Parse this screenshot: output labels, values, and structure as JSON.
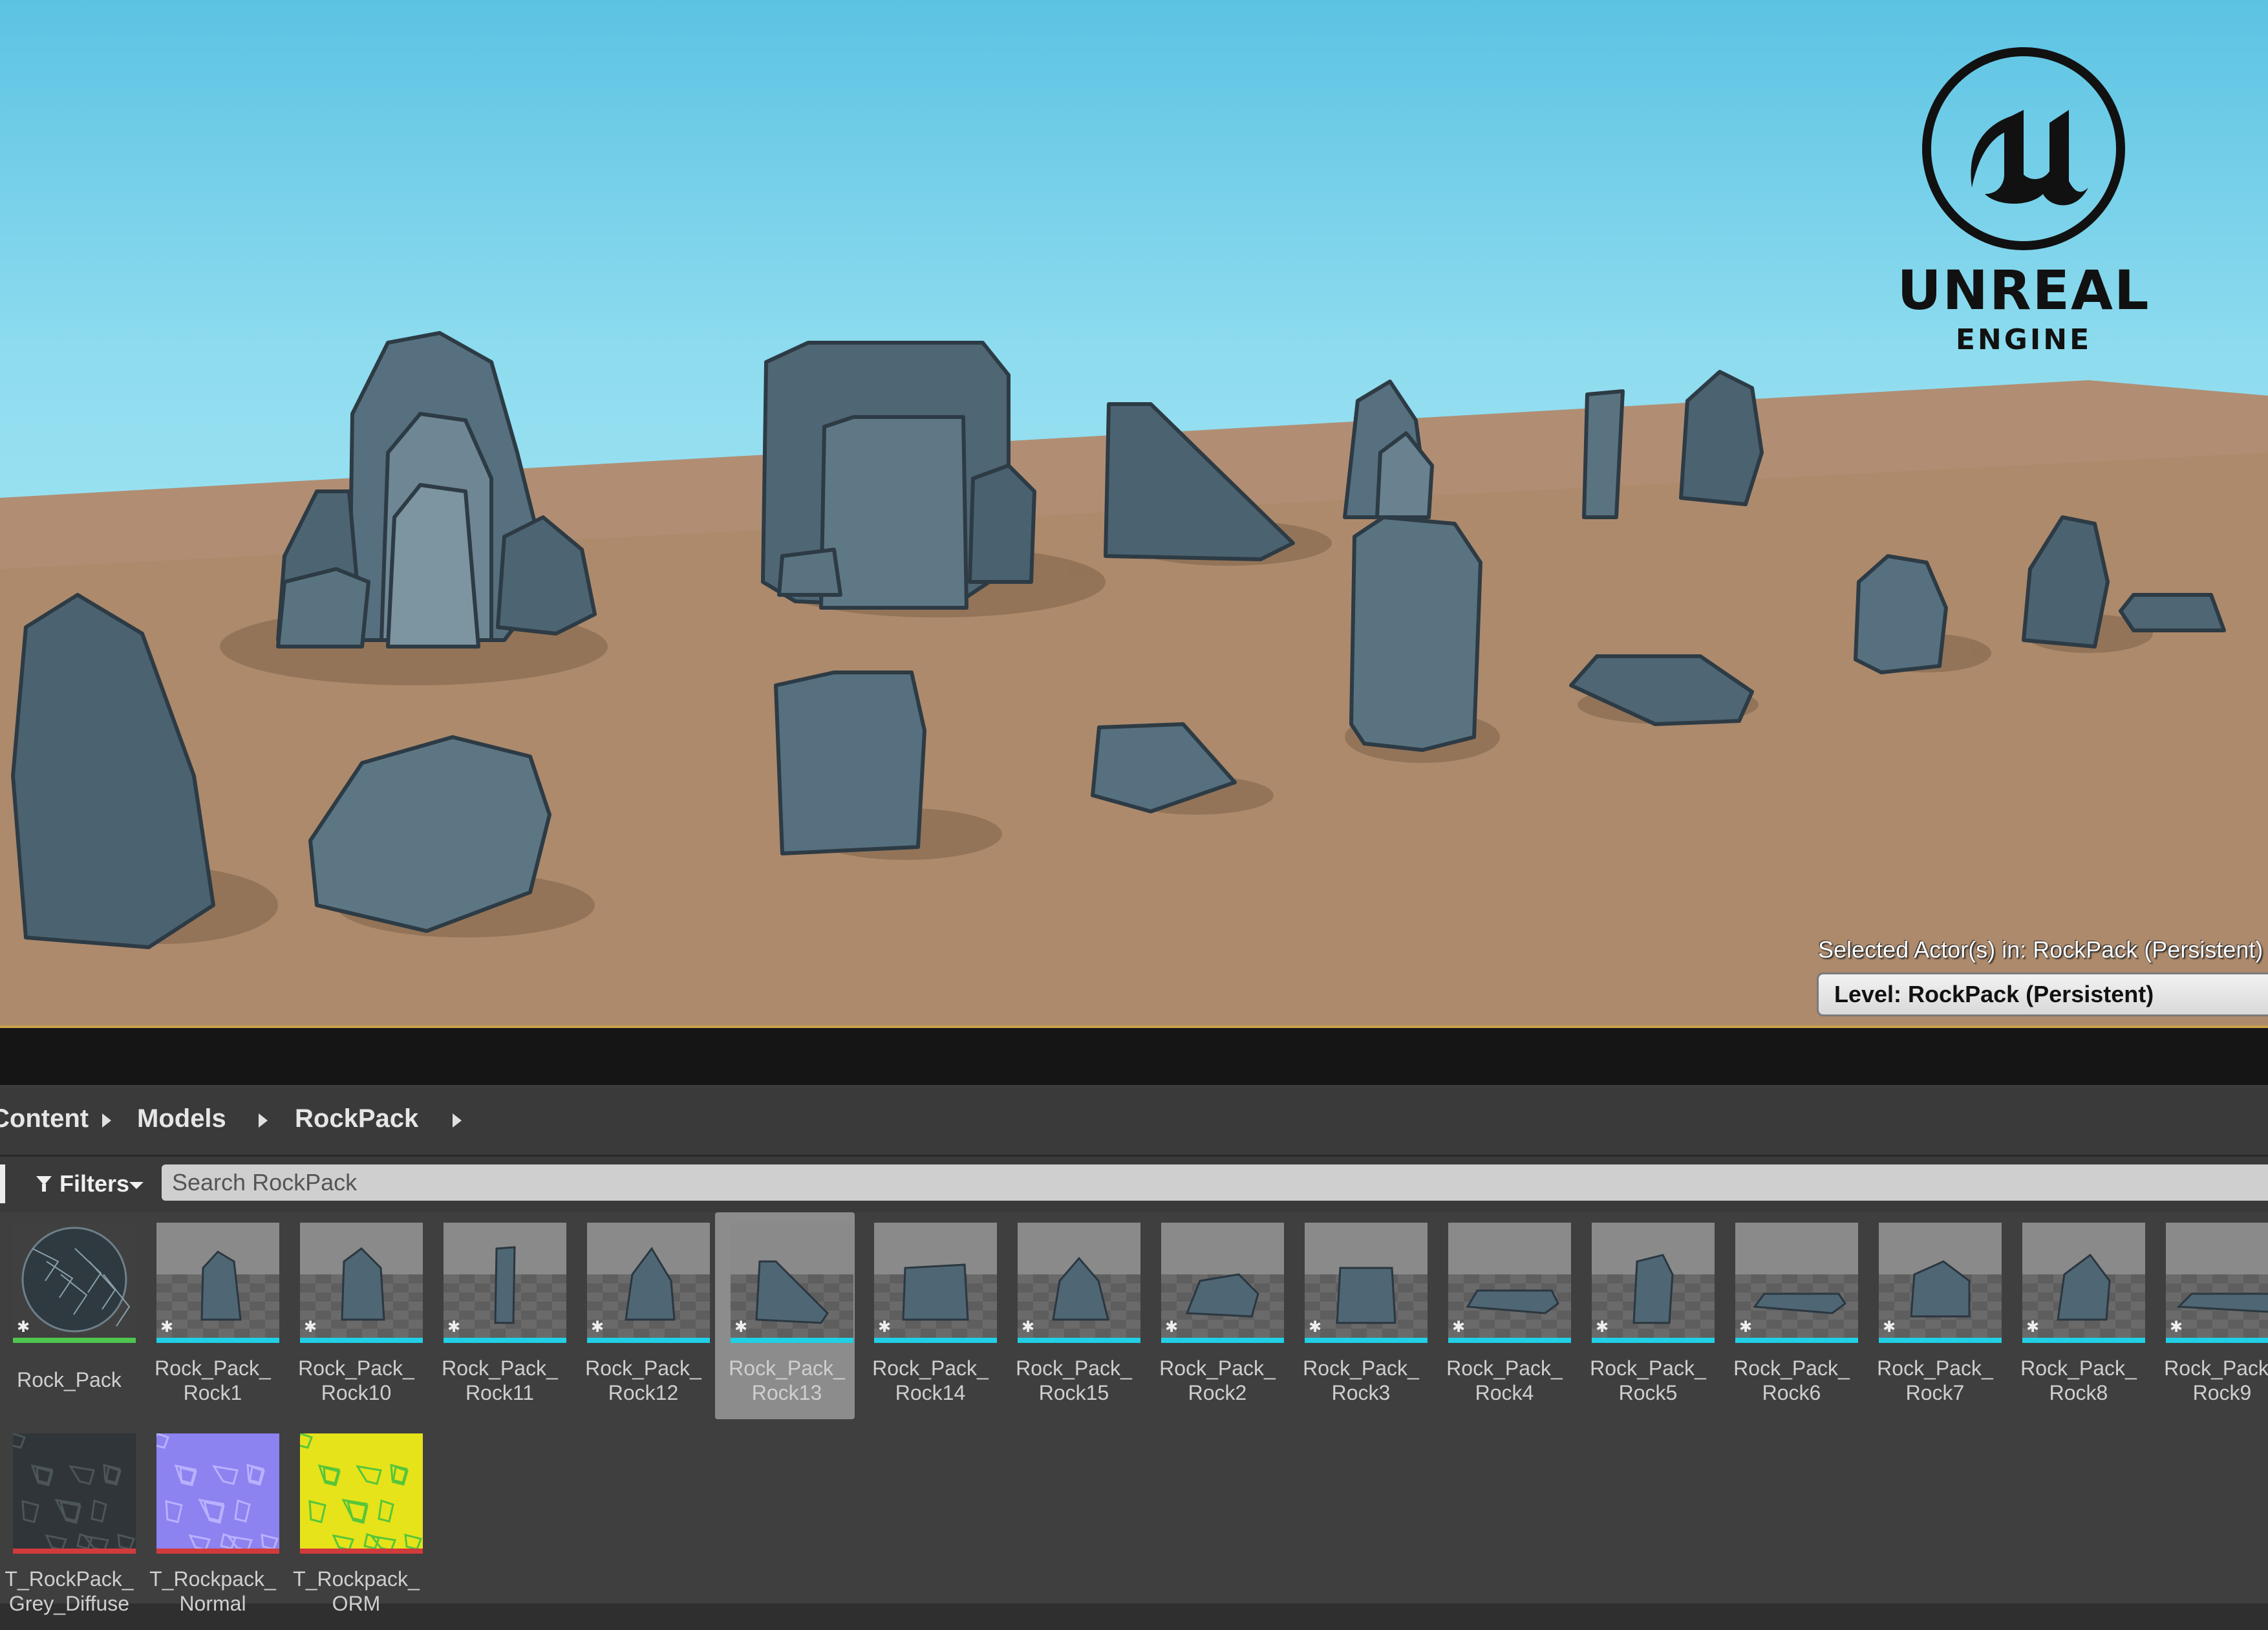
{
  "logo": {
    "word1": "UNREAL",
    "word2": "ENGINE",
    "icon": "unreal-engine-logo"
  },
  "viewport": {
    "selected_actors": "Selected Actor(s) in:  RockPack (Persistent)",
    "level_label": "Level:  RockPack (Persistent)"
  },
  "breadcrumb": {
    "items": [
      "Content",
      "Models",
      "RockPack"
    ]
  },
  "toolbar": {
    "filters_label": "Filters",
    "search_placeholder": "Search RockPack"
  },
  "assets": [
    {
      "line1": "Rock_Pack",
      "line2": "",
      "kind": "material",
      "bar": "#4fc64f"
    },
    {
      "line1": "Rock_Pack_",
      "line2": "Rock1",
      "kind": "mesh",
      "bar": "#1fd0e6"
    },
    {
      "line1": "Rock_Pack_",
      "line2": "Rock10",
      "kind": "mesh",
      "bar": "#1fd0e6"
    },
    {
      "line1": "Rock_Pack_",
      "line2": "Rock11",
      "kind": "mesh",
      "bar": "#1fd0e6"
    },
    {
      "line1": "Rock_Pack_",
      "line2": "Rock12",
      "kind": "mesh",
      "bar": "#1fd0e6"
    },
    {
      "line1": "Rock_Pack_",
      "line2": "Rock13",
      "kind": "mesh",
      "bar": "#1fd0e6",
      "selected": true
    },
    {
      "line1": "Rock_Pack_",
      "line2": "Rock14",
      "kind": "mesh",
      "bar": "#1fd0e6"
    },
    {
      "line1": "Rock_Pack_",
      "line2": "Rock15",
      "kind": "mesh",
      "bar": "#1fd0e6"
    },
    {
      "line1": "Rock_Pack_",
      "line2": "Rock2",
      "kind": "mesh",
      "bar": "#1fd0e6"
    },
    {
      "line1": "Rock_Pack_",
      "line2": "Rock3",
      "kind": "mesh",
      "bar": "#1fd0e6"
    },
    {
      "line1": "Rock_Pack_",
      "line2": "Rock4",
      "kind": "mesh",
      "bar": "#1fd0e6"
    },
    {
      "line1": "Rock_Pack_",
      "line2": "Rock5",
      "kind": "mesh",
      "bar": "#1fd0e6"
    },
    {
      "line1": "Rock_Pack_",
      "line2": "Rock6",
      "kind": "mesh",
      "bar": "#1fd0e6"
    },
    {
      "line1": "Rock_Pack_",
      "line2": "Rock7",
      "kind": "mesh",
      "bar": "#1fd0e6"
    },
    {
      "line1": "Rock_Pack_",
      "line2": "Rock8",
      "kind": "mesh",
      "bar": "#1fd0e6"
    },
    {
      "line1": "Rock_Pack_",
      "line2": "Rock9",
      "kind": "mesh",
      "bar": "#1fd0e6"
    },
    {
      "line1": "T_RockPack_",
      "line2": "Grey_Diffuse",
      "kind": "texture-diffuse",
      "bar": "#d23b3b"
    },
    {
      "line1": "T_Rockpack_",
      "line2": "Normal",
      "kind": "texture-normal",
      "bar": "#d23b3b"
    },
    {
      "line1": "T_Rockpack_",
      "line2": "ORM",
      "kind": "texture-orm",
      "bar": "#d23b3b"
    }
  ],
  "colors": {
    "sky_top": "#5cc3e3",
    "ground": "#b08c6e",
    "rock": "#4f6674",
    "viewport_border": "#c9a24a",
    "panel_bg": "#3f3f3f"
  }
}
